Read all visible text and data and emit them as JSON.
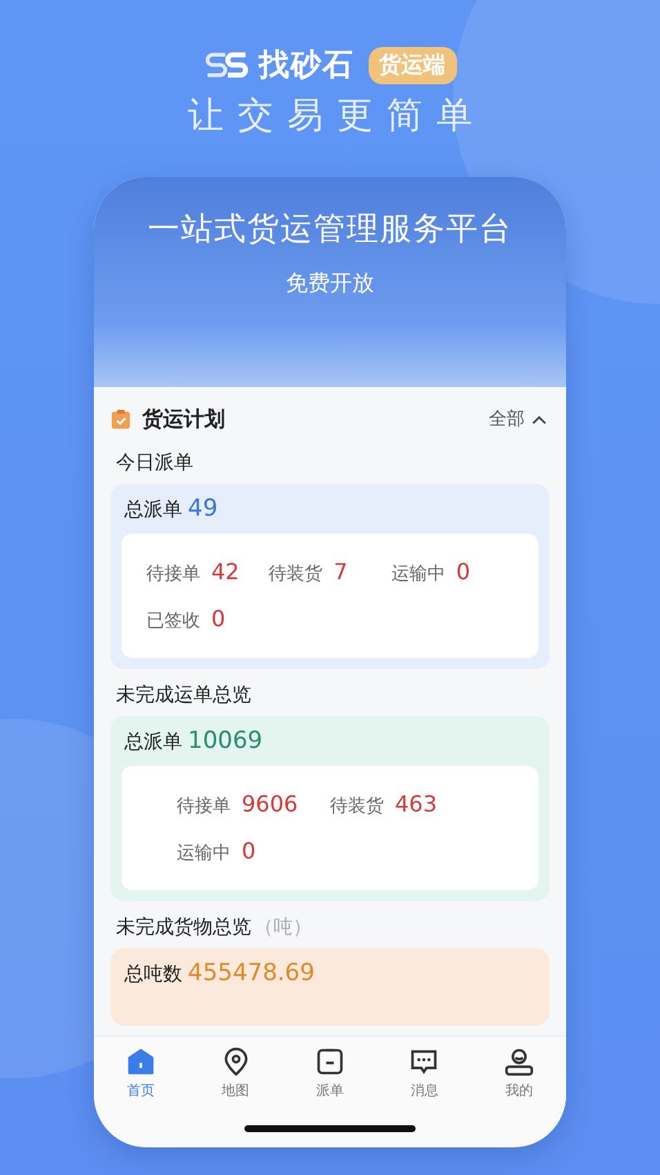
{
  "header": {
    "logo_text": "找砂石",
    "badge": "货运端",
    "slogan": "让交易更简单"
  },
  "banner": {
    "title": "一站式货运管理服务平台",
    "subtitle": "免费开放"
  },
  "panel": {
    "title": "货运计划",
    "filter": "全部",
    "expanded": true
  },
  "sections": [
    {
      "kind": "today",
      "title": "今日派单",
      "total_label": "总派单",
      "total": "49",
      "stats": [
        {
          "label": "待接单",
          "value": "42"
        },
        {
          "label": "待装货",
          "value": "7"
        },
        {
          "label": "运输中",
          "value": "0"
        },
        {
          "label": "已签收",
          "value": "0"
        }
      ]
    },
    {
      "kind": "orders",
      "title": "未完成运单总览",
      "total_label": "总派单",
      "total": "10069",
      "stats": [
        {
          "label": "待接单",
          "value": "9606"
        },
        {
          "label": "待装货",
          "value": "463"
        },
        {
          "label": "运输中",
          "value": "0"
        }
      ]
    },
    {
      "kind": "goods",
      "title": "未完成货物总览",
      "unit": "（吨）",
      "total_label": "总吨数",
      "total": "455478.69"
    }
  ],
  "tabs": [
    {
      "kind": "home",
      "label": "首页",
      "selected": true
    },
    {
      "kind": "map",
      "label": "地图",
      "selected": false
    },
    {
      "kind": "dispatch",
      "label": "派单",
      "selected": false
    },
    {
      "kind": "message",
      "label": "消息",
      "selected": false
    },
    {
      "kind": "profile",
      "label": "我的",
      "selected": false
    }
  ]
}
